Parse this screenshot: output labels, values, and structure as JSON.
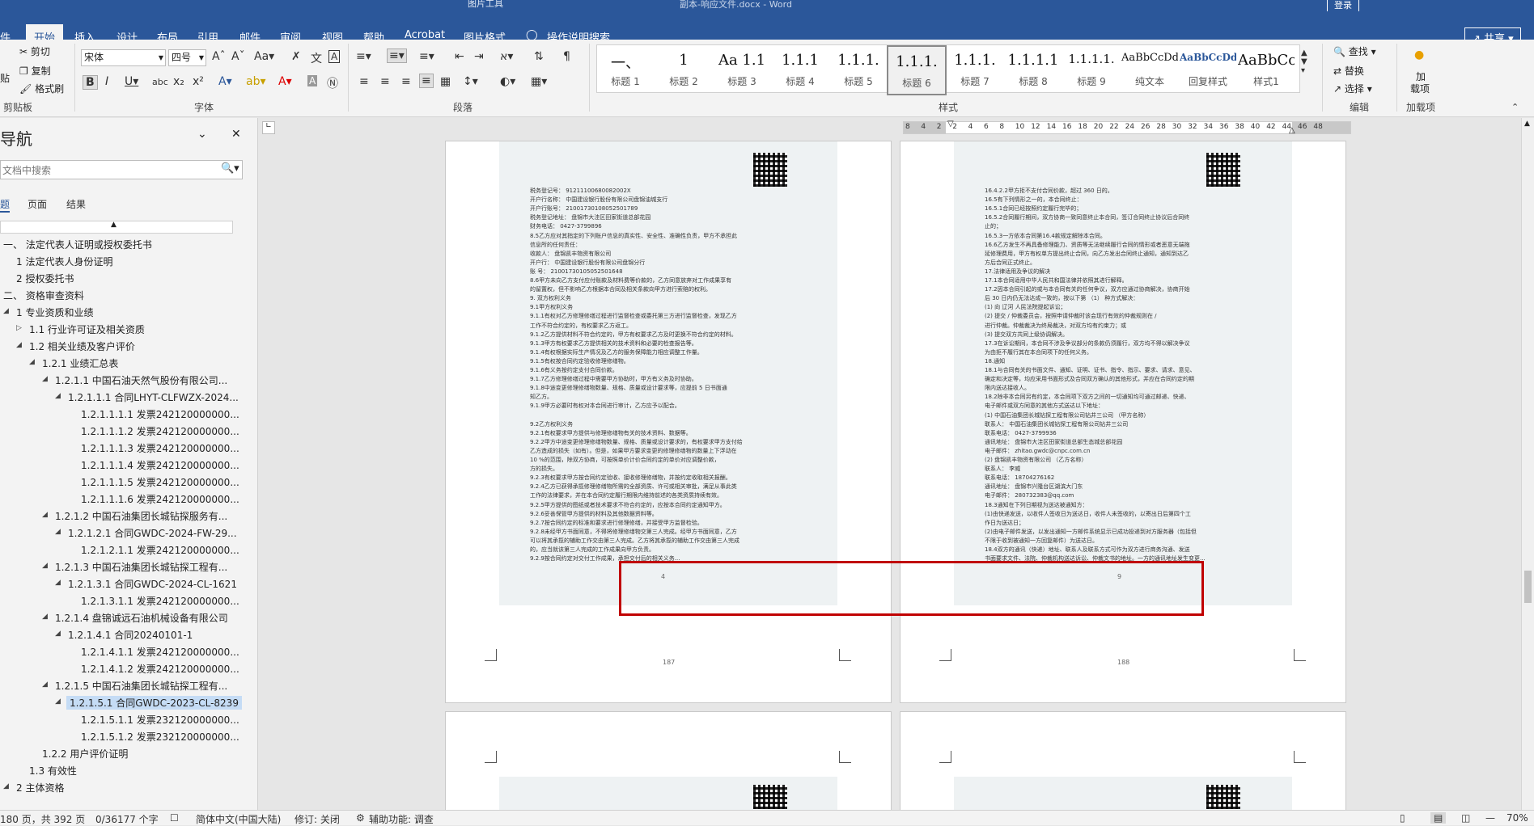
{
  "window": {
    "title": "副本-响应文件.docx - Word",
    "picture_tools_label": "图片工具",
    "signin_label": "登录",
    "share_label": "共享"
  },
  "tabs": [
    "件",
    "开始",
    "插入",
    "设计",
    "布局",
    "引用",
    "邮件",
    "审阅",
    "视图",
    "帮助",
    "Acrobat",
    "图片格式",
    "操作说明搜索"
  ],
  "ribbon": {
    "clipboard": {
      "cut": "剪切",
      "copy": "复制",
      "format_painter": "格式刷",
      "paste": "贴",
      "label": "剪贴板"
    },
    "font": {
      "name": "宋体",
      "size": "四号",
      "label": "字体"
    },
    "paragraph": {
      "label": "段落"
    },
    "styles": {
      "label": "样式",
      "items": [
        {
          "sample": "一、",
          "name": "标题 1"
        },
        {
          "sample": "1",
          "name": "标题 2"
        },
        {
          "sample": "Aa 1.1",
          "name": "标题 3"
        },
        {
          "sample": "1.1.1",
          "name": "标题 4"
        },
        {
          "sample": "1.1.1.",
          "name": "标题 5"
        },
        {
          "sample": "1.1.1.",
          "name": "标题 6"
        },
        {
          "sample": "1.1.1.",
          "name": "标题 7"
        },
        {
          "sample": "1.1.1.1",
          "name": "标题 8"
        },
        {
          "sample": "1.1.1.1.",
          "name": "标题 9"
        },
        {
          "sample": "AaBbCcDd",
          "name": "纯文本"
        },
        {
          "sample": "AaBbCcDd",
          "name": "回复样式"
        },
        {
          "sample": "AaBbCc",
          "name": "样式1"
        }
      ]
    },
    "editing": {
      "find": "查找",
      "replace": "替换",
      "select": "选择",
      "label": "编辑"
    },
    "addins": {
      "load": "加",
      "load2": "载项",
      "label": "加载项"
    }
  },
  "nav": {
    "title": "导航",
    "search_placeholder": "文档中搜索",
    "tabs": [
      "题",
      "页面",
      "结果"
    ],
    "items": [
      {
        "text": "一、 法定代表人证明或授权委托书"
      },
      {
        "text": "1 法定代表人身份证明"
      },
      {
        "text": "2 授权委托书"
      },
      {
        "text": "二、 资格审查资料"
      },
      {
        "text": "1 专业资质和业绩"
      },
      {
        "text": "1.1 行业许可证及相关资质"
      },
      {
        "text": "1.2 相关业绩及客户评价"
      },
      {
        "text": "1.2.1 业绩汇总表"
      },
      {
        "text": "1.2.1.1 中国石油天然气股份有限公司..."
      },
      {
        "text": "1.2.1.1.1 合同LHYT-CLFWZX-2024..."
      },
      {
        "text": "1.2.1.1.1.1 发票242120000000..."
      },
      {
        "text": "1.2.1.1.1.2 发票242120000000..."
      },
      {
        "text": "1.2.1.1.1.3 发票242120000000..."
      },
      {
        "text": "1.2.1.1.1.4 发票242120000000..."
      },
      {
        "text": "1.2.1.1.1.5 发票242120000000..."
      },
      {
        "text": "1.2.1.1.1.6 发票242120000000..."
      },
      {
        "text": "1.2.1.2 中国石油集团长城钻探服务有..."
      },
      {
        "text": "1.2.1.2.1 合同GWDC-2024-FW-29..."
      },
      {
        "text": "1.2.1.2.1.1 发票242120000000..."
      },
      {
        "text": "1.2.1.3 中国石油集团长城钻探工程有..."
      },
      {
        "text": "1.2.1.3.1 合同GWDC-2024-CL-1621"
      },
      {
        "text": "1.2.1.3.1.1 发票242120000000..."
      },
      {
        "text": "1.2.1.4 盘锦诚远石油机械设备有限公司"
      },
      {
        "text": "1.2.1.4.1 合同20240101-1"
      },
      {
        "text": "1.2.1.4.1.1 发票242120000000..."
      },
      {
        "text": "1.2.1.4.1.2 发票242120000000..."
      },
      {
        "text": "1.2.1.5 中国石油集团长城钻探工程有..."
      },
      {
        "text": "1.2.1.5.1 合同GWDC-2023-CL-8239"
      },
      {
        "text": "1.2.1.5.1.1 发票232120000000..."
      },
      {
        "text": "1.2.1.5.1.2 发票232120000000..."
      },
      {
        "text": "1.2.2 用户评价证明"
      },
      {
        "text": "1.3 有效性"
      },
      {
        "text": "2 主体资格"
      }
    ]
  },
  "ruler": [
    "8",
    "4",
    "2",
    "2",
    "4",
    "6",
    "8",
    "10",
    "12",
    "14",
    "16",
    "18",
    "20",
    "22",
    "24",
    "26",
    "28",
    "30",
    "32",
    "34",
    "36",
    "38",
    "40",
    "42",
    "44",
    "46",
    "48"
  ],
  "pages": {
    "left": {
      "lines": [
        "税务登记号：  91211100680082002X",
        "开户行名称：    中国建设银行股份有限公司盘锦油城支行",
        "开户行账号：   21001730108052501789",
        "税务登记地址：   盘锦市大洼区田家街道总部花园",
        "财务电话：      0427-3799896",
        "8.5乙方应对其指定的下列账户信息的真实性、安全性、准确性负责，甲方不承担此",
        "信息所的任何责任：",
        "    收款人：   盘锦凯丰物资有限公司",
        "    开户行：   中国建设银行股份有限公司盘锦分行",
        "    账 号：   21001730105052501648",
        "8.6甲方未向乙方支付应付账款及材料费等价款的，乙方同意放弃对工作成果享有",
        "的留置权，但不影响乙方根据本合同及相关条款向甲方进行索赔的权利。",
        "9. 双方权利义务",
        "9.1甲方权利义务",
        "9.1.1有权对乙方修理修缮过程进行监督检查或委托第三方进行监督检查，发现乙方",
        "工作不符合约定的，有权要求乙方返工。",
        "9.1.2乙方提供材料不符合约定的，甲方有权要求乙方及时更换不符合约定的材料。",
        "9.1.3甲方有权要求乙方提供相关的技术资料和必要的检查报告等。",
        "9.1.4有权根据实际生产情况及乙方的服务保障能力相应调整工作量。",
        "9.1.5有权按合同约定验收修理修缮物。",
        "9.1.6有义务按约定支付合同价款。",
        "9.1.7乙方修理修缮过程中需要甲方协助时，甲方有义务及时协助。",
        "9.1.8中途变更修理修缮物数量、规格、质量或设计要求等，应提前 5 日书面通",
        "知乙方。",
        "9.1.9甲方必要时有权对本合同进行审计，乙方应予以配合。",
        "",
        "9.2乙方权利义务",
        "9.2.1有权要求甲方提供与修理修缮物有关的技术资料、数据等。",
        "9.2.2甲方中途变更修理修缮物数量、规格、质量或设计要求的，有权要求甲方支付给",
        "乙方造成的损失（如有）。但是，如果甲方要求变更的修理修缮物的数量上下浮动在",
        "10 %的范围，除双方协商，可按照单价计价合同约定的单价对应调整价款，",
        "方的损失。",
        "9.2.3有权要求甲方按合同约定验收、接收修理修缮物，并按约定收取相关报酬。",
        "9.2.4乙方已获得承揽修理修缮物所需的全部资质、许可或相关审批，满足从事此类",
        "工作的法律要求，并在本合同约定履行期限内维持前述的各类资质持续有效。",
        "9.2.5甲方提供的图纸或者技术要求不符合约定的，应按本合同约定通知甲方。",
        "9.2.6妥善保管甲方提供的材料及其他数据资料等。",
        "9.2.7按合同约定的标准和要求进行修理修缮，并接受甲方监督检验。",
        "9.2.8未经甲方书面同意，不得将修理修缮物交第三人完成。经甲方书面同意，乙方",
        "可以将其承揽的辅助工作交由第三人完成。乙方将其承揽的辅助工作交由第三人完成",
        "的，应当就该第三人完成的工作成果向甲方负责。",
        "9.2.9按合同约定对交付工作成果，承担交付后的相关义务..."
      ],
      "page_num": "4",
      "footer_num": "187"
    },
    "right": {
      "lines": [
        "16.4.2.2甲方拒不支付合同价款，超过   360    日的。",
        "16.5有下列情形之一的，本合同终止：",
        "16.5.1合同已经按照约定履行完毕的；",
        "16.5.2合同履行期间，双方协商一致同意终止本合同，签订合同终止协议后合同终",
        "止的；",
        "16.5.3一方依本合同第16.4款规定解除本合同。",
        "16.6乙方发生不再具备修理能力、资质等无法继续履行合同的情形或者恶意无端拖",
        "延修理费用，甲方有权单方提出终止合同，向乙方发出合同终止通知，通知到达乙",
        "方后合同正式终止。",
        "17.法律适用及争议的解决",
        "17.1本合同适用中华人民共和国法律并依照其进行解释。",
        "17.2因本合同引起的或与本合同有关的任何争议，双方应通过协商解决，协商开始",
        "后  30  日内仍无法达成一致的，按以下第  （1）  种方式解决：",
        "  (1) 向     辽河       人民法院提起诉讼；",
        "  (2) 提交   /   仲裁委员会，按照申请仲裁时该会现行有效的仲裁规则在   /",
        "      进行仲裁。仲裁裁决为终局裁决，对双方均有约束力；或",
        "  (3) 提交双方共同上级协调解决。",
        "17.3在诉讼期间，本合同不涉及争议部分的条款仍须履行，双方均不得以解决争议",
        "为由拒不履行其在本合同项下的任何义务。",
        "18.通知",
        "18.1与合同有关的书面文件、通知、证明、证书、指令、指示、要求、请求、意见、",
        "确定和决定等，均应采用书面形式及合同双方确认的其他形式，并应在合同约定的期",
        "限内送达接收人。",
        "18.2除非本合同另有约定，本合同项下双方之间的一切通知均可通过邮递、快递、",
        "电子邮件或双方同意的其他方式送达以下地址：",
        "  (1) 中国石油集团长城钻探工程有限公司钻井三公司  （甲方名称）",
        "      联系人：   中国石油集团长城钻探工程有限公司钻井三公司",
        "      联系电话：   0427-3799936",
        "      通讯地址：   盘锦市大洼区田家街道总部生态城总部花园",
        "      电子邮件：   zhitao.gwdc@cnpc.com.cn",
        "  (2)   盘锦凯丰物资有限公司   （乙方名称）",
        "      联系人：   李威",
        "      联系电话：   18704276162",
        "      通讯地址：   盘锦市兴隆台区湖滨大门东",
        "      电子邮件：   280732383@qq.com",
        "18.3通知在下列日期视为送达被通知方：",
        "(1)由快递发送，以收件人签收日为送达日，收件人未签收的，以寄出日后第四个工",
        "作日为送达日；",
        "(2)由电子邮件发送，以发出通知一方邮件系统显示已成功投递到对方服务器（包括但",
        "不限于收到被通知一方回复邮件）为送达日。",
        "18.4双方的通讯（快递）地址、联系人及联系方式可作为双方进行商务沟通、发送",
        "书面要求文件、法院、仲裁机构送达诉讼、仲裁文书的地址。一方的通讯地址发生变更..."
      ],
      "page_num": "9",
      "footer_num": "188"
    }
  },
  "status": {
    "page": "180 页，共 392 页",
    "words": "0/36177 个字",
    "language": "简体中文(中国大陆)",
    "track": "修订: 关闭",
    "accessibility": "辅助功能: 调查",
    "zoom": "70%"
  },
  "colors": {
    "brand": "#2b579a",
    "highlight_box": "#c00000",
    "selected_nav": "#c5dcf5"
  }
}
